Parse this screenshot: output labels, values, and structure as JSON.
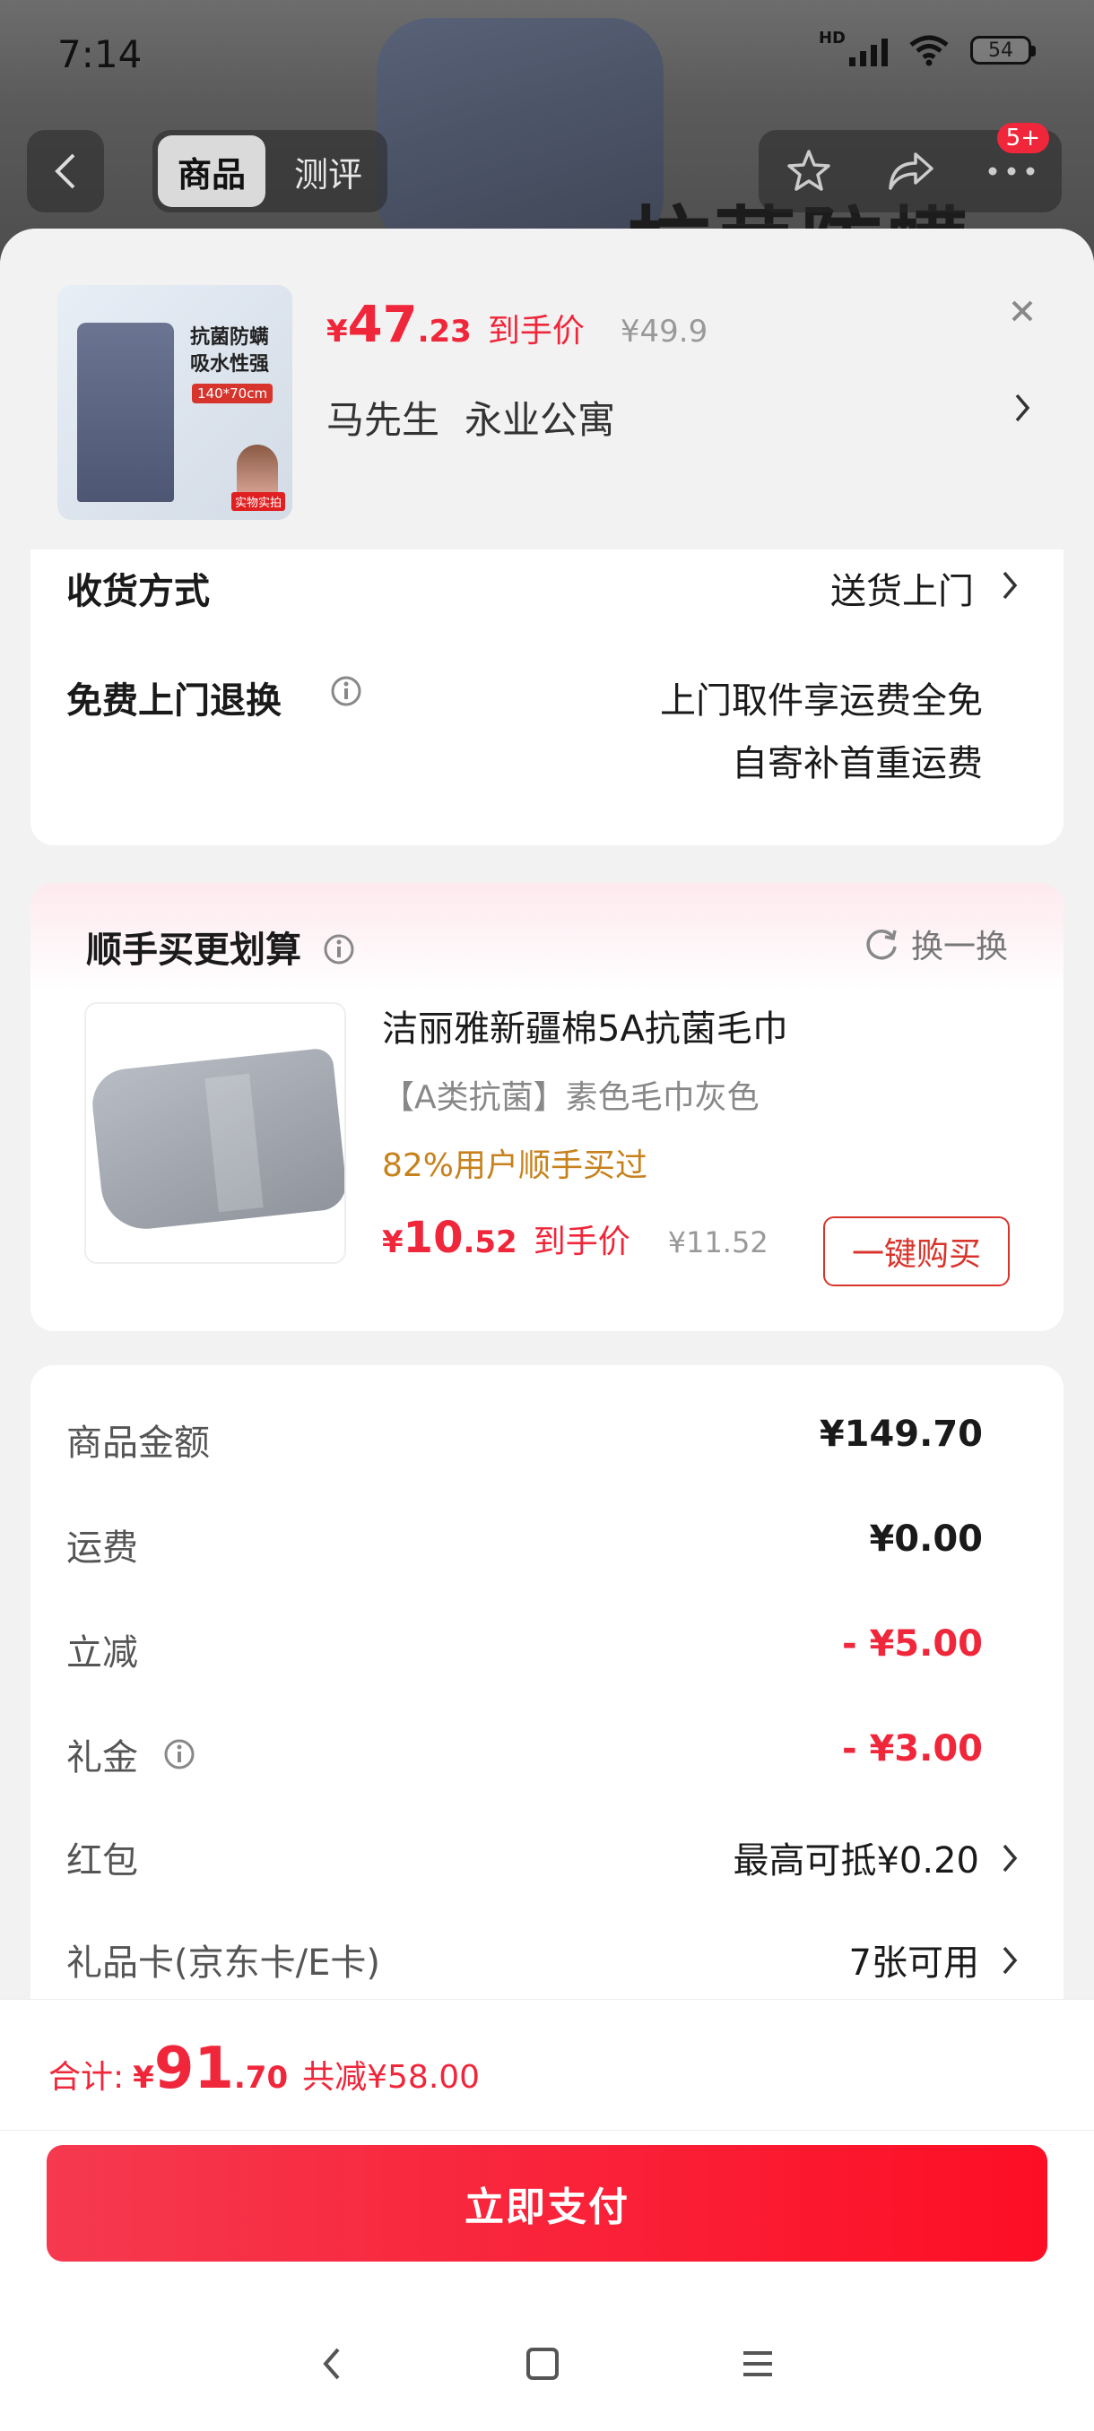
{
  "status_bar": {
    "time": "7:14",
    "network": "HD",
    "battery": "54"
  },
  "nav": {
    "tabs": [
      "商品",
      "测评"
    ],
    "active_tab": "商品",
    "badge": "5+"
  },
  "background": {
    "title": "抗菌防螨"
  },
  "product": {
    "thumb_text": "抗菌防螨吸水性强",
    "thumb_tag": "140*70cm",
    "price_currency": "¥",
    "price_int": "47",
    "price_dec": ".23",
    "price_label": "到手价",
    "original_price": "¥49.9",
    "address_name": "马先生",
    "address_place": "永业公寓"
  },
  "delivery": {
    "method_label": "收货方式",
    "method_value": "送货上门",
    "return_label": "免费上门退换",
    "return_line1": "上门取件享运费全免",
    "return_line2": "自寄补首重运费"
  },
  "upsell": {
    "title": "顺手买更划算",
    "swap_label": "换一换",
    "item_name": "洁丽雅新疆棉5A抗菌毛巾",
    "item_spec": "【A类抗菌】素色毛巾灰色",
    "item_popularity": "82%用户顺手买过",
    "price_currency": "¥",
    "price_int": "10",
    "price_dec": ".52",
    "price_label": "到手价",
    "original_price": "¥11.52",
    "buy_button": "一键购买"
  },
  "summary": {
    "rows": [
      {
        "label": "商品金额",
        "value": "¥149.70"
      },
      {
        "label": "运费",
        "value": "¥0.00"
      },
      {
        "label": "立减",
        "value": "- ¥5.00"
      },
      {
        "label": "礼金",
        "value": "- ¥3.00"
      },
      {
        "label": "红包",
        "value": "最高可抵¥0.20"
      },
      {
        "label": "礼品卡(京东卡/E卡)",
        "value": "7张可用"
      }
    ]
  },
  "footer": {
    "total_label": "合计:",
    "currency": "¥",
    "total_int": "91",
    "total_dec": ".70",
    "saving": "共减¥58.00",
    "pay_button": "立即支付"
  },
  "colors": {
    "accent": "#f0263a",
    "upsell_orange": "#c7821e",
    "button_border": "#d9342b"
  }
}
